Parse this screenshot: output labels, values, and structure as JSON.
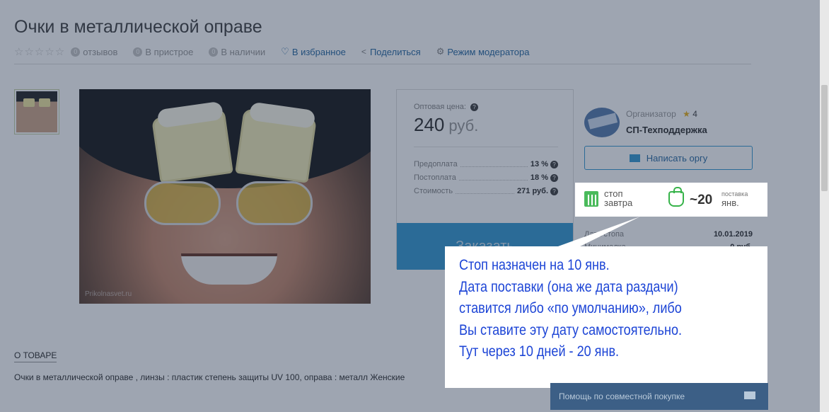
{
  "product": {
    "title": "Очки в металлической оправе",
    "stars": "☆☆☆☆☆",
    "reviews_count": "0",
    "reviews_label": "отзывов",
    "pristroy_count": "0",
    "pristroy_label": "В пристрое",
    "stock_count": "0",
    "stock_label": "В наличии",
    "favorite_label": "В избранное",
    "share_label": "Поделиться",
    "moderator_label": "Режим модератора",
    "watermark": "Prikolnasvet.ru"
  },
  "price": {
    "label": "Оптовая цена:",
    "value": "240",
    "unit": "руб.",
    "prepay_label": "Предоплата",
    "prepay_value": "13 %",
    "postpay_label": "Постоплата",
    "postpay_value": "18 %",
    "cost_label": "Стоимость",
    "cost_value": "271 руб.",
    "order_button": "Заказать"
  },
  "organizer": {
    "label": "Организатор",
    "rating": "4",
    "name": "СП-Техподдержка",
    "write_button": "Написать оргу"
  },
  "stop_info": {
    "stop_label": "Дата стопа",
    "stop_value": "10.01.2019",
    "min_label": "Минималка",
    "min_value": "0 руб."
  },
  "highlight": {
    "stop_word": "стоп",
    "stop_when": "завтра",
    "delivery_days": "~20",
    "delivery_label": "поставка",
    "delivery_month": "янв."
  },
  "callout": {
    "lines": [
      "Стоп назначен на 10 янв.",
      "Дата поставки (она же дата раздачи)",
      "ставится либо «по умолчанию», либо",
      "Вы ставите эту дату самостоятельно.",
      "Тут через 10 дней - 20 янв."
    ]
  },
  "about": {
    "heading": "О ТОВАРЕ",
    "description": "Очки в металлической оправе , линзы : пластик степень защиты UV 100, оправа : металл Женские"
  },
  "help": {
    "label": "Помощь по совместной покупке"
  },
  "colors": {
    "accent": "#3a9bd2",
    "callout_text": "#1d45d6",
    "icon_green": "#37b34a"
  }
}
